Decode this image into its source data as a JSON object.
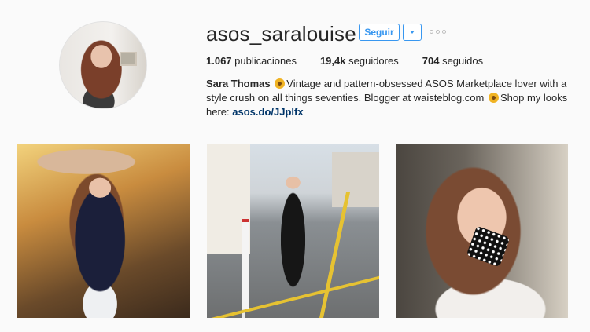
{
  "profile": {
    "username": "asos_saralouise",
    "follow_label": "Seguir",
    "stats": {
      "posts_count": "1.067",
      "posts_label": "publicaciones",
      "followers_count": "19,4k",
      "followers_label": "seguidores",
      "following_count": "704",
      "following_label": "seguidos"
    },
    "bio": {
      "name": "Sara Thomas",
      "text_1": "Vintage and pattern-obsessed ASOS Marketplace lover with a style crush on all things seventies. Blogger at waisteblog.com",
      "text_2": "Shop my looks here:",
      "link": "asos.do/JJplfx"
    },
    "icons": {
      "dropdown": "chevron-down-icon",
      "more": "more-options-icon",
      "emoji": "sunflower-emoji-icon"
    }
  },
  "posts": [
    {
      "alt": "post-1"
    },
    {
      "alt": "post-2"
    },
    {
      "alt": "post-3"
    }
  ],
  "colors": {
    "accent": "#3897f0",
    "link": "#003569",
    "text": "#262626",
    "background": "#fafafa"
  }
}
